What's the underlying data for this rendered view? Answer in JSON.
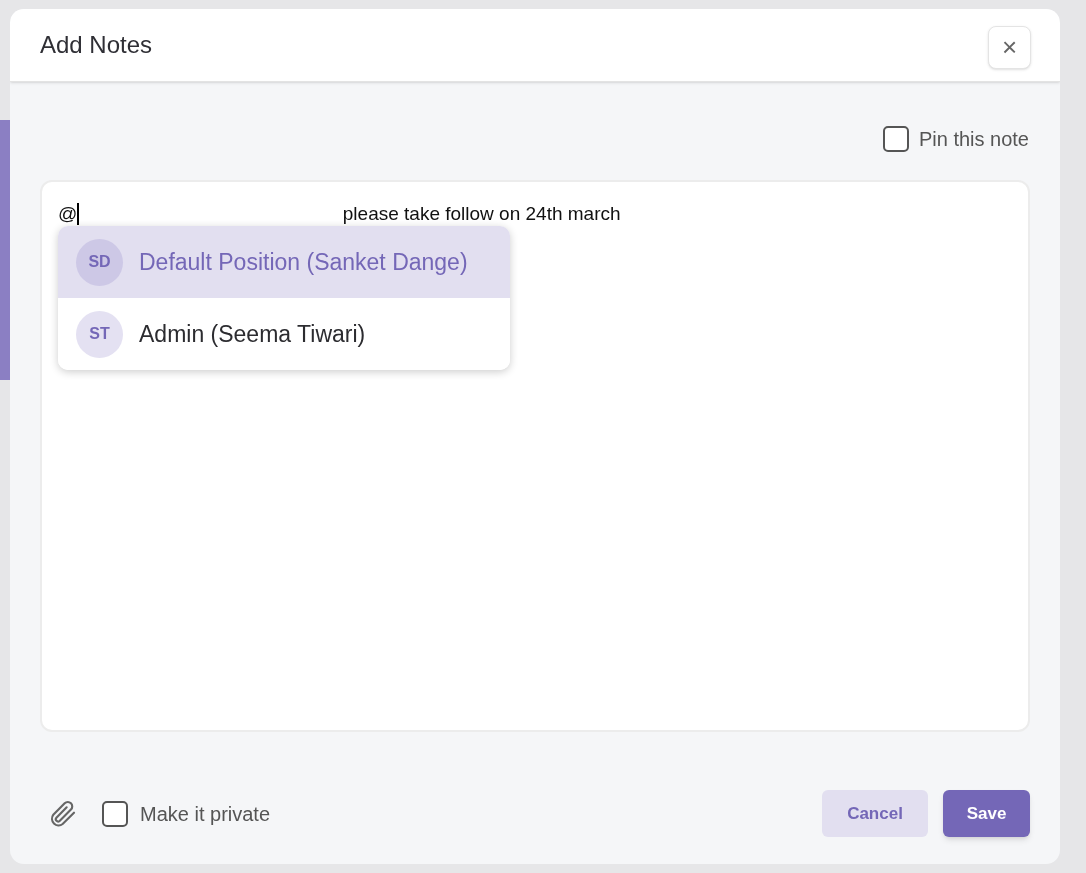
{
  "dialog": {
    "title": "Add Notes",
    "close_icon": "×"
  },
  "pin": {
    "label": "Pin this note",
    "checked": false
  },
  "editor": {
    "trigger": "@",
    "text": "please take follow on 24th march"
  },
  "mentions": [
    {
      "initials": "SD",
      "name": "Default Position (Sanket Dange)",
      "selected": true
    },
    {
      "initials": "ST",
      "name": "Admin (Seema Tiwari)",
      "selected": false
    }
  ],
  "private": {
    "label": "Make it private",
    "checked": false
  },
  "buttons": {
    "cancel": "Cancel",
    "save": "Save"
  }
}
